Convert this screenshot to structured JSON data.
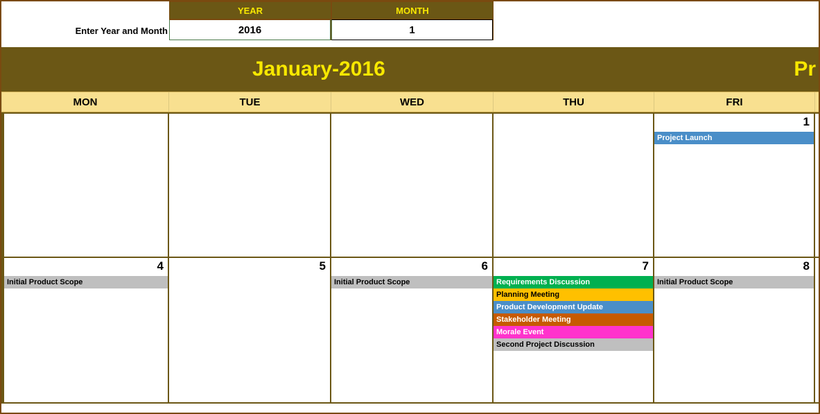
{
  "input": {
    "label": "Enter Year and Month",
    "year_header": "YEAR",
    "month_header": "MONTH",
    "year_value": "2016",
    "month_value": "1"
  },
  "title": {
    "main": "January-2016",
    "right_partial": "Pr"
  },
  "dow": {
    "mon": "MON",
    "tue": "TUE",
    "wed": "WED",
    "thu": "THU",
    "fri": "FRI"
  },
  "rows": [
    {
      "cells": [
        {
          "date": "",
          "events": []
        },
        {
          "date": "",
          "events": []
        },
        {
          "date": "",
          "events": []
        },
        {
          "date": "",
          "events": []
        },
        {
          "date": "1",
          "events": [
            {
              "text": "Project Launch",
              "cls": "ev-blue"
            }
          ]
        }
      ]
    },
    {
      "cells": [
        {
          "date": "4",
          "events": [
            {
              "text": "Initial Product Scope",
              "cls": "ev-gray"
            }
          ]
        },
        {
          "date": "5",
          "events": []
        },
        {
          "date": "6",
          "events": [
            {
              "text": "Initial Product Scope",
              "cls": "ev-gray"
            }
          ]
        },
        {
          "date": "7",
          "events": [
            {
              "text": "Requirements Discussion",
              "cls": "ev-green"
            },
            {
              "text": "Planning Meeting",
              "cls": "ev-yellow"
            },
            {
              "text": "Product Development Update",
              "cls": "ev-blue"
            },
            {
              "text": "Stakeholder Meeting",
              "cls": "ev-brown"
            },
            {
              "text": "Morale Event",
              "cls": "ev-pink"
            },
            {
              "text": "Second Project Discussion",
              "cls": "ev-gray"
            }
          ]
        },
        {
          "date": "8",
          "events": [
            {
              "text": "Initial Product Scope",
              "cls": "ev-gray"
            }
          ]
        }
      ]
    }
  ]
}
